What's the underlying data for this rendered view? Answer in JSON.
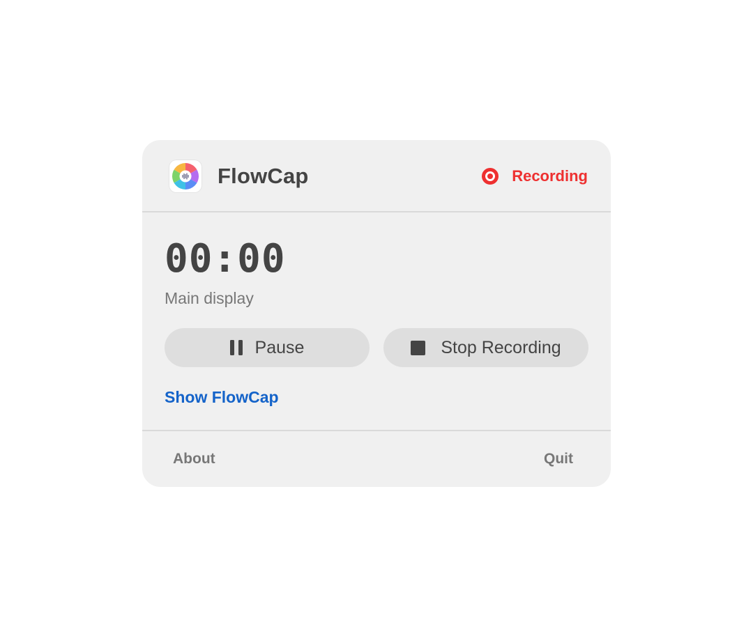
{
  "app": {
    "title": "FlowCap",
    "icon": "flowcap-logo-icon"
  },
  "status": {
    "label": "Recording",
    "color": "#ee3030",
    "icon": "record-dot-icon"
  },
  "timer": {
    "elapsed": "00:00",
    "source": "Main display"
  },
  "controls": {
    "pause_label": "Pause",
    "pause_icon": "pause-icon",
    "stop_label": "Stop Recording",
    "stop_icon": "stop-icon"
  },
  "links": {
    "show_app": "Show FlowCap",
    "link_color": "#1463c9"
  },
  "footer": {
    "about": "About",
    "quit": "Quit"
  }
}
